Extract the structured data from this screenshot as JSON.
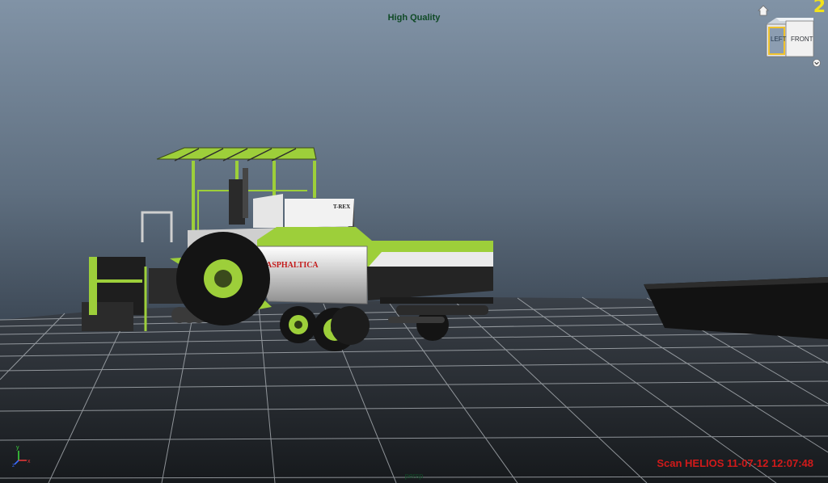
{
  "viewport": {
    "hud_title": "High Quality",
    "camera_label": "persp",
    "scan_stamp": "Scan HELIOS 11-07-12 12:07:48",
    "layer_number": "2"
  },
  "viewcube": {
    "face_left": "LEFT",
    "face_front": "FRONT"
  },
  "model": {
    "brand_top": "T-REX",
    "brand_side": "ASPHALTICA"
  },
  "axis_gizmo": {
    "y": "y",
    "x": "x",
    "z": "z"
  },
  "colors": {
    "machine_green": "#9dcf3a",
    "hud_text": "#0f4a26",
    "stamp_red": "#d11a1a",
    "layer_yellow": "#f2e21a"
  },
  "icons": [
    "home-icon",
    "viewcube-icon",
    "chevron-down-icon",
    "axis-gizmo-icon"
  ]
}
